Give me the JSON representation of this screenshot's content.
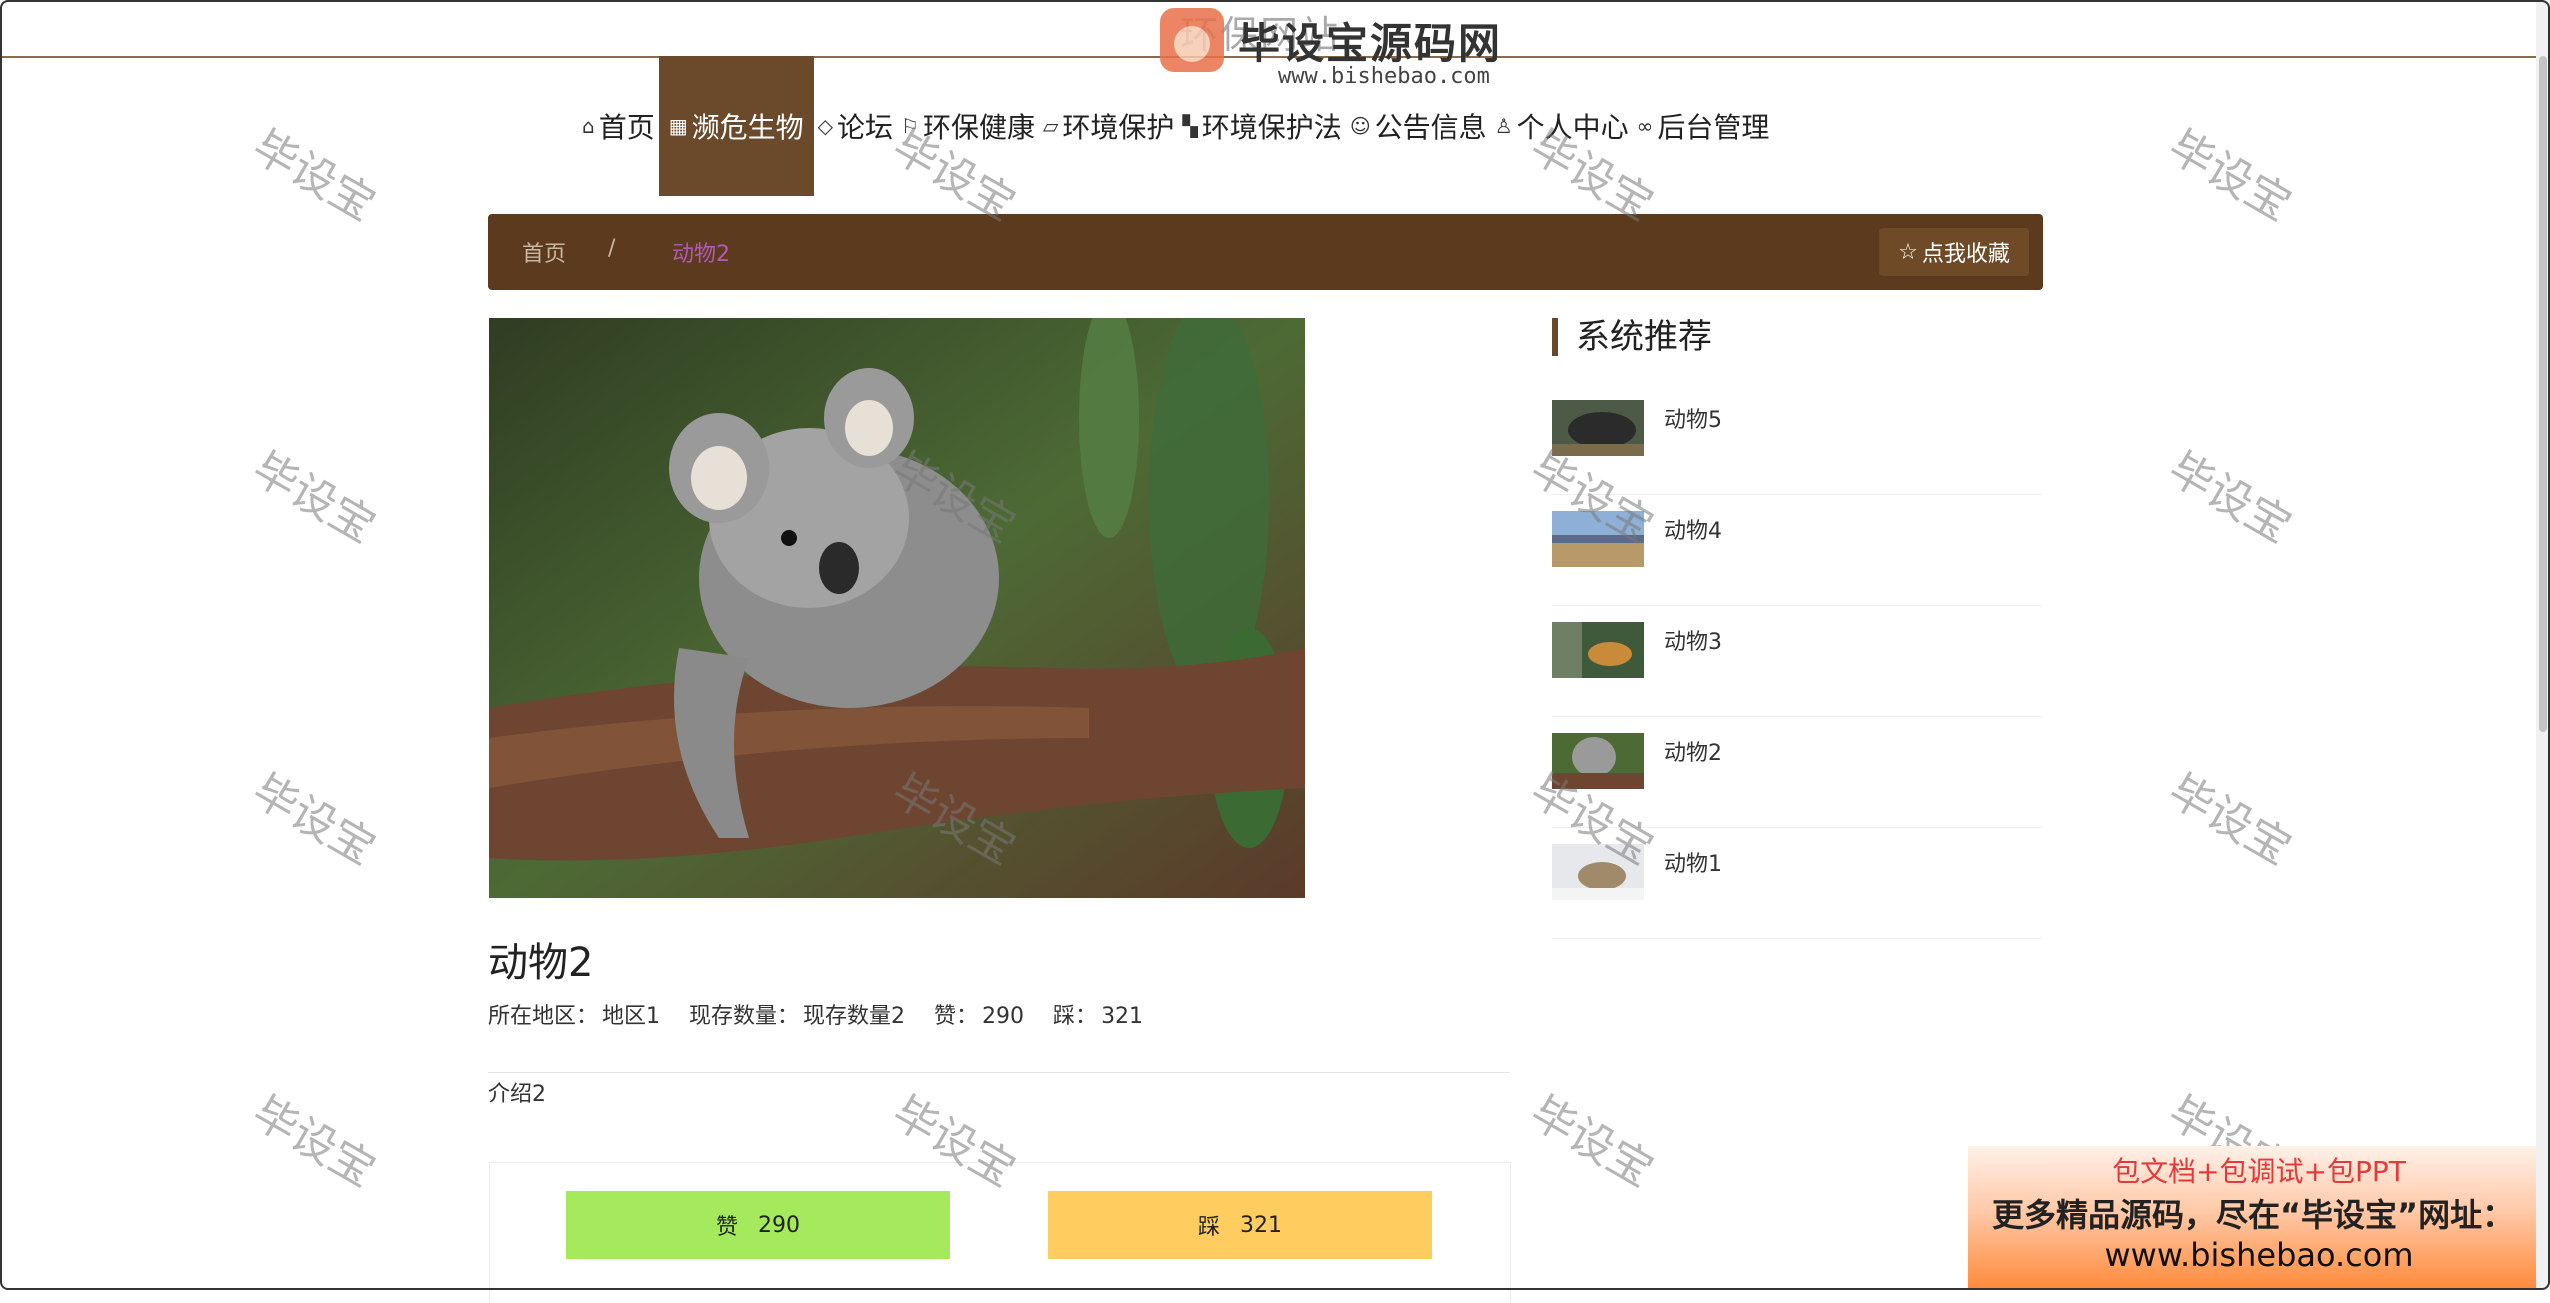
{
  "site": {
    "title": "环保网站",
    "logo_text": "毕设宝源码网",
    "logo_url": "www.bishebao.com"
  },
  "nav": [
    {
      "label": "首页",
      "icon": "home-icon",
      "active": false
    },
    {
      "label": "濒危生物",
      "icon": "grid-icon",
      "active": true
    },
    {
      "label": "论坛",
      "icon": "cube-icon",
      "active": false
    },
    {
      "label": "环保健康",
      "icon": "flag-icon",
      "active": false
    },
    {
      "label": "环境保护",
      "icon": "tag-icon",
      "active": false
    },
    {
      "label": "环境保护法",
      "icon": "apps-icon",
      "active": false
    },
    {
      "label": "公告信息",
      "icon": "palette-icon",
      "active": false
    },
    {
      "label": "个人中心",
      "icon": "user-icon",
      "active": false
    },
    {
      "label": "后台管理",
      "icon": "link-icon",
      "active": false
    }
  ],
  "breadcrumb": {
    "home": "首页",
    "separator": "/",
    "current": "动物2"
  },
  "favorite_label": "点我收藏",
  "detail": {
    "title": "动物2",
    "region_label": "所在地区：",
    "region": "地区1",
    "count_label": "现存数量：",
    "count": "现存数量2",
    "likes_label": "赞：",
    "likes": "290",
    "dislikes_label": "踩：",
    "dislikes": "321",
    "intro": "介绍2"
  },
  "vote": {
    "like_label": "赞",
    "like_count": "290",
    "dislike_label": "踩",
    "dislike_count": "321"
  },
  "sidebar": {
    "title": "系统推荐",
    "items": [
      {
        "name": "动物5"
      },
      {
        "name": "动物4"
      },
      {
        "name": "动物3"
      },
      {
        "name": "动物2"
      },
      {
        "name": "动物1"
      }
    ]
  },
  "watermark": "毕设宝",
  "ad": {
    "line1": "包文档+包调试+包PPT",
    "line2": "更多精品源码，尽在“毕设宝”网址：",
    "line3": "www.bishebao.com"
  },
  "colors": {
    "nav_active": "#6b4a2b",
    "breadcrumb_bg": "#5c3a1e",
    "like_btn": "#a5ea5c",
    "dislike_btn": "#ffcc5f",
    "crumb_current": "#b05ab4"
  }
}
